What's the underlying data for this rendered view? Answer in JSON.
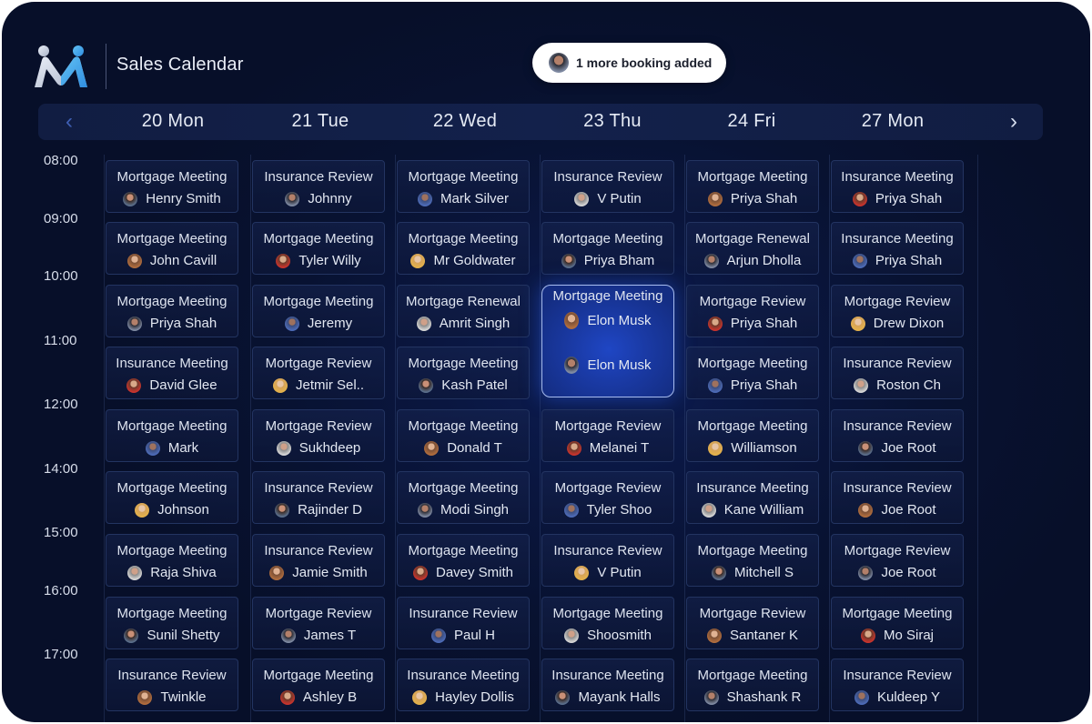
{
  "header": {
    "app_title": "Sales Calendar",
    "logo_icon": "brand-m-logo-icon",
    "toast": {
      "text": "1 more booking added",
      "avatar": "person-avatar-icon"
    }
  },
  "nav": {
    "prev_icon": "chevron-left-icon",
    "prev_glyph": "‹",
    "next_icon": "chevron-right-icon",
    "next_glyph": "›"
  },
  "days": [
    "20 Mon",
    "21 Tue",
    "22 Wed",
    "23 Thu",
    "24 Fri",
    "27 Mon"
  ],
  "times": [
    "08:00",
    "09:00",
    "10:00",
    "11:00",
    "12:00",
    "14:00",
    "15:00",
    "16:00",
    "17:00"
  ],
  "columns": [
    [
      {
        "title": "Mortgage Meeting",
        "name": "Henry Smith"
      },
      {
        "title": "Mortgage Meeting",
        "name": "John Cavill"
      },
      {
        "title": "Mortgage Meeting",
        "name": "Priya Shah"
      },
      {
        "title": "Insurance Meeting",
        "name": "David Glee"
      },
      {
        "title": "Mortgage Meeting",
        "name": "Mark"
      },
      {
        "title": "Mortgage Meeting",
        "name": "Johnson"
      },
      {
        "title": "Mortgage Meeting",
        "name": "Raja Shiva"
      },
      {
        "title": "Mortgage Meeting",
        "name": "Sunil Shetty"
      },
      {
        "title": "Insurance Review",
        "name": "Twinkle"
      }
    ],
    [
      {
        "title": "Insurance Review",
        "name": "Johnny"
      },
      {
        "title": "Mortgage Meeting",
        "name": "Tyler Willy"
      },
      {
        "title": "Mortgage Meeting",
        "name": "Jeremy"
      },
      {
        "title": "Mortgage Review",
        "name": "Jetmir Sel.."
      },
      {
        "title": "Mortgage Review",
        "name": "Sukhdeep"
      },
      {
        "title": "Insurance Review",
        "name": "Rajinder D"
      },
      {
        "title": "Insurance Review",
        "name": "Jamie Smith"
      },
      {
        "title": "Mortgage Review",
        "name": "James T"
      },
      {
        "title": "Mortgage Meeting",
        "name": "Ashley B"
      }
    ],
    [
      {
        "title": "Mortgage Meeting",
        "name": "Mark Silver"
      },
      {
        "title": "Mortgage Meeting",
        "name": "Mr Goldwater"
      },
      {
        "title": "Mortgage Renewal",
        "name": "Amrit Singh"
      },
      {
        "title": "Mortgage Meeting",
        "name": "Kash Patel"
      },
      {
        "title": "Mortgage Meeting",
        "name": "Donald T"
      },
      {
        "title": "Mortgage Meeting",
        "name": "Modi Singh"
      },
      {
        "title": "Mortgage Meeting",
        "name": "Davey Smith"
      },
      {
        "title": "Insurance Review",
        "name": "Paul H"
      },
      {
        "title": "Insurance Meeting",
        "name": "Hayley Dollis"
      }
    ],
    [
      {
        "title": "Insurance Review",
        "name": "V Putin"
      },
      {
        "title": "Mortgage Meeting",
        "name": "Priya  Bham"
      },
      {
        "title": "Mortgage Meeting",
        "name": "Elon Musk",
        "featured": true,
        "second_name": "Elon Musk"
      },
      {
        "title": "Mortgage Review",
        "name": "Melanei T"
      },
      {
        "title": "Mortgage Review",
        "name": "Tyler Shoo"
      },
      {
        "title": "Insurance Review",
        "name": "V Putin"
      },
      {
        "title": "Mortgage Meeting",
        "name": "Shoosmith"
      },
      {
        "title": "Insurance Meeting",
        "name": "Mayank Halls"
      }
    ],
    [
      {
        "title": "Mortgage Meeting",
        "name": "Priya Shah"
      },
      {
        "title": "Mortgage Renewal",
        "name": "Arjun Dholla"
      },
      {
        "title": "Mortgage Review",
        "name": "Priya Shah"
      },
      {
        "title": "Mortgage Meeting",
        "name": "Priya Shah"
      },
      {
        "title": "Mortgage Meeting",
        "name": "Williamson"
      },
      {
        "title": "Insurance Meeting",
        "name": "Kane William"
      },
      {
        "title": "Mortgage Meeting",
        "name": "Mitchell S"
      },
      {
        "title": "Mortgage Review",
        "name": "Santaner K"
      },
      {
        "title": "Mortgage Meeting",
        "name": "Shashank R"
      }
    ],
    [
      {
        "title": "Insurance Meeting",
        "name": "Priya Shah"
      },
      {
        "title": "Insurance Meeting",
        "name": "Priya Shah"
      },
      {
        "title": "Mortgage Review",
        "name": "Drew Dixon"
      },
      {
        "title": "Insurance Review",
        "name": "Roston Ch"
      },
      {
        "title": "Insurance Review",
        "name": "Joe Root"
      },
      {
        "title": "Insurance Review",
        "name": "Joe Root"
      },
      {
        "title": "Mortgage Review",
        "name": "Joe Root"
      },
      {
        "title": "Mortgage Meeting",
        "name": "Mo Siraj"
      },
      {
        "title": "Insurance Review",
        "name": "Kuldeep Y"
      }
    ]
  ]
}
